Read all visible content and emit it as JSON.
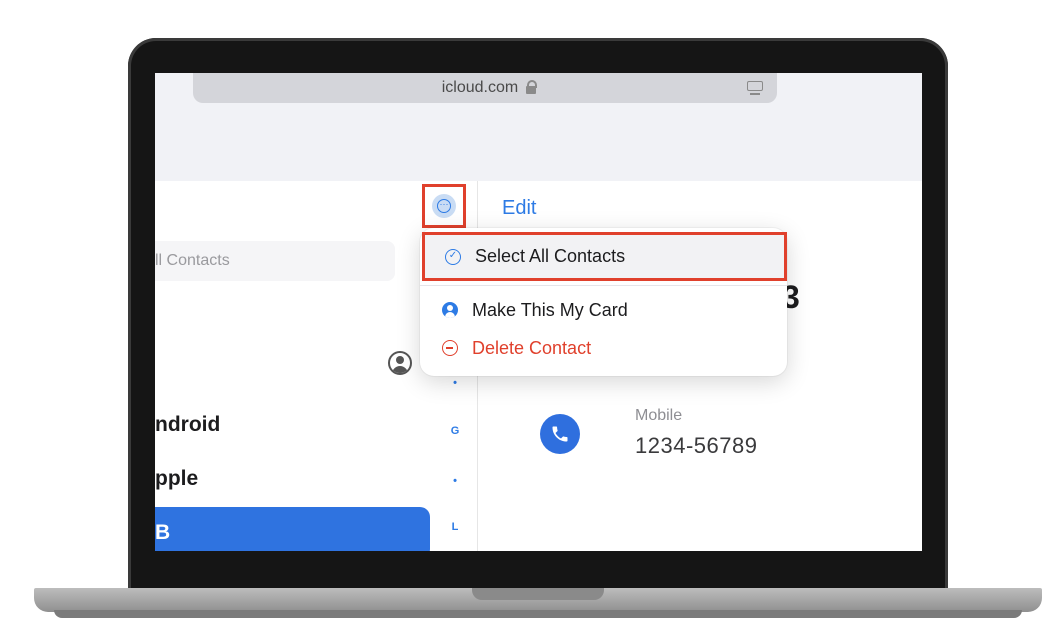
{
  "browser": {
    "url": "icloud.com",
    "apple_icon": "apple-logo-icon",
    "lock_icon": "lock-icon",
    "tabs_icon": "tab-overview-icon"
  },
  "sidebar": {
    "more_button_icon": "ellipsis-circle-icon",
    "search_placeholder": "ll Contacts",
    "profile_icon": "person-circle-icon",
    "contacts": [
      {
        "label": "ndroid"
      },
      {
        "label": "pple"
      },
      {
        "label": "B",
        "selected": true
      }
    ],
    "index_letters": [
      "•",
      "G",
      "•",
      "L"
    ]
  },
  "detail": {
    "edit_label": "Edit",
    "name_partial": "3",
    "phone_icon": "phone-icon",
    "phone_label": "Mobile",
    "phone_value": "1234-56789"
  },
  "menu": {
    "items": [
      {
        "label": "Select All Contacts",
        "icon": "checkmark-circle-icon",
        "highlighted": true
      },
      {
        "label": "Make This My Card",
        "icon": "person-circle-icon"
      },
      {
        "label": "Delete Contact",
        "icon": "minus-circle-icon",
        "destructive": true
      }
    ]
  },
  "colors": {
    "accent": "#2d7be5",
    "selection": "#2f73e0",
    "destructive": "#e0402c",
    "highlight_border": "#e0402c"
  }
}
